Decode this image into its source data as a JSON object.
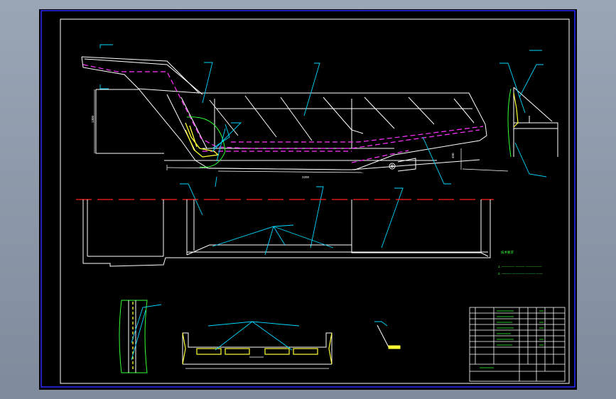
{
  "colors": {
    "background": "#000000",
    "outer_frame": "#2b2bff",
    "inner_frame": "#ffffff",
    "outline": "#ffffff",
    "dashed_magenta": "#ff33ff",
    "leader_cyan": "#00d8ff",
    "weld_yellow": "#ffff33",
    "section_red": "#ff2020",
    "notes_green": "#33ff33"
  },
  "icons": [
    "weld-symbol-icon",
    "section-arrow-icon"
  ]
}
